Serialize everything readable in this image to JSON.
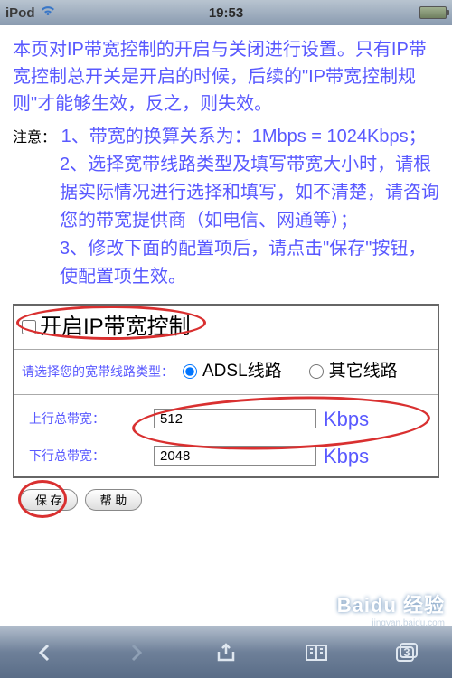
{
  "status": {
    "device": "iPod",
    "time": "19:53"
  },
  "intro": "本页对IP带宽控制的开启与关闭进行设置。只有IP带宽控制总开关是开启的时候，后续的\"IP带宽控制规则\"才能够生效，反之，则失效。",
  "note_label": "注意：",
  "notes": {
    "n1": "1、带宽的换算关系为：1Mbps = 1024Kbps；",
    "n2": "2、选择宽带线路类型及填写带宽大小时，请根据实际情况进行选择和填写，如不清楚，请咨询您的带宽提供商（如电信、网通等）；",
    "n3": "3、修改下面的配置项后，请点击\"保存\"按钮，使配置项生效。"
  },
  "form": {
    "enable_label": "开启IP带宽控制",
    "type_label": "请选择您的宽带线路类型：",
    "radio_adsl": "ADSL线路",
    "radio_other": "其它线路",
    "up_label": "上行总带宽：",
    "up_value": "512",
    "down_label": "下行总带宽：",
    "down_value": "2048",
    "unit": "Kbps"
  },
  "buttons": {
    "save": "保 存",
    "help": "帮 助"
  },
  "toolbar": {
    "tab_count": "3"
  },
  "watermark": {
    "brand": "Baidu 经验",
    "url": "jingyan.baidu.com"
  }
}
